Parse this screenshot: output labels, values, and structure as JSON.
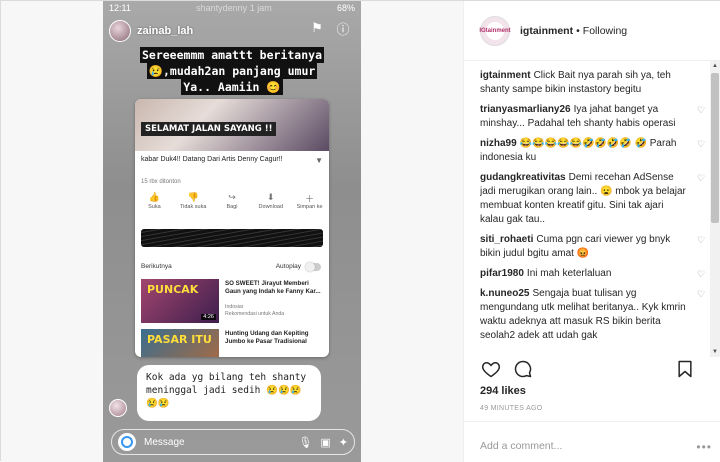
{
  "story": {
    "status_time": "12:11",
    "status_right": "68%",
    "ghost_username": "shantydenny",
    "ghost_time": "1 jam",
    "username": "zainab_lah",
    "caption_lines": [
      "Sereeemmm amattt beritanya",
      "😢,mudah2an panjang umur",
      "Ya.. Aamiin 😊"
    ],
    "video_title_overlay": "SELAMAT JALAN SAYANG !!",
    "video_title": "kabar Duk4!! Datang Dari Artis Denny Cagur!!",
    "video_views": "15 rbx ditonton",
    "actions": [
      {
        "glyph": "👍",
        "label": "Suka"
      },
      {
        "glyph": "👎",
        "label": "Tidak suka"
      },
      {
        "glyph": "↪",
        "label": "Bagi"
      },
      {
        "glyph": "⬇",
        "label": "Download"
      },
      {
        "glyph": "＋",
        "label": "Simpan ke"
      }
    ],
    "next_label": "Berikutnya",
    "autoplay_label": "Autoplay",
    "up_next": [
      {
        "thumb_text": "PUNCAK",
        "duration": "4:26",
        "title": "SO SWEET! Jirayut Memberi Gaun yang Indah ke Fanny Kar...",
        "channel": "Indosiar",
        "sub": "Rekomendasi untuk Anda"
      },
      {
        "thumb_text": "PASAR ITU",
        "duration": "",
        "title": "Hunting Udang dan Kepiting Jumbo ke Pasar Tradisional",
        "channel": "",
        "sub": ""
      }
    ],
    "reply_text": "Kok ada yg bilang teh shanty meninggal jadi sedih 😢😢😢😢😢",
    "message_placeholder": "Message"
  },
  "post": {
    "account": "igtainment",
    "logo_text": "IGtainment",
    "follow_state": "Following",
    "comments": [
      {
        "user": "igtainment",
        "text": "Click Bait nya parah sih ya, teh shanty sampe bikin instastory begitu",
        "like": false
      },
      {
        "user": "trianyasmarliany26",
        "text": "Iya jahat banget ya minshay... Padahal teh shanty habis operasi",
        "like": true
      },
      {
        "user": "nizha99",
        "text": "😂😂😂😂😂🤣🤣🤣🤣 🤣 Parah indonesia ku",
        "like": true
      },
      {
        "user": "gudangkreativitas",
        "text": "Demi recehan AdSense jadi merugikan orang lain.. 😦 mbok ya belajar membuat konten kreatif gitu. Sini tak ajari kalau gak tau..",
        "like": true
      },
      {
        "user": "siti_rohaeti",
        "text": "Cuma pgn cari viewer yg bnyk bikin judul bgitu amat 😡",
        "like": true
      },
      {
        "user": "pifar1980",
        "text": "Ini mah keterlaluan",
        "like": true
      },
      {
        "user": "k.nuneo25",
        "text": "Sengaja buat tulisan yg mengundang utk melihat beritanya.. Kyk kmrin waktu adeknya att masuk RS bikin berita seolah2 adek att udah gak",
        "like": true
      }
    ],
    "likes": "294 likes",
    "time": "49 MINUTES AGO",
    "add_comment_placeholder": "Add a comment...",
    "more_label": "•••"
  }
}
